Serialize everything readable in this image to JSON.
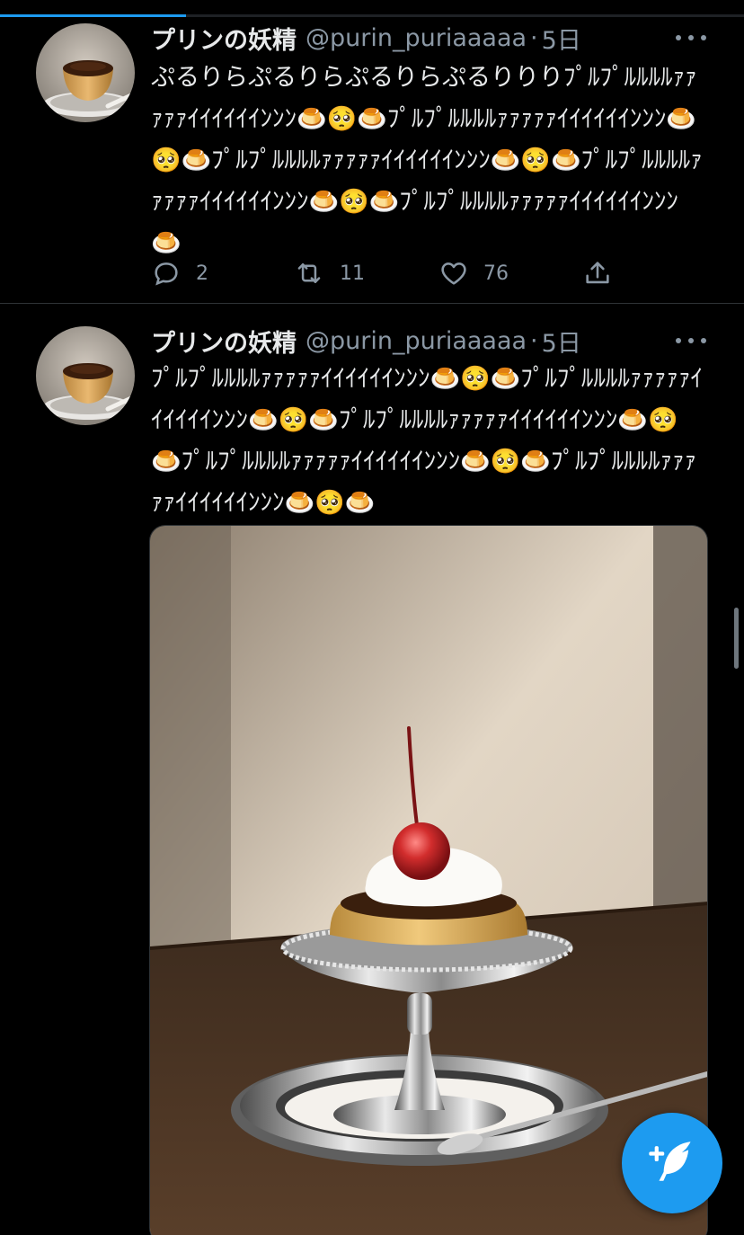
{
  "progress": {
    "fraction": 0.25,
    "color": "#1d9bf0"
  },
  "tweets": [
    {
      "author_name": "プリンの妖精",
      "handle": "@purin_puriaaaaa",
      "separator": "·",
      "time": "5日",
      "text": "ぷるりらぷるりらぷるりらぷるりりりﾌﾟﾙﾌﾟﾙﾙﾙﾙｧｧｧｧｧｲｲｲｲｲｲﾝﾝﾝ🍮🥺🍮ﾌﾟﾙﾌﾟﾙﾙﾙﾙｧｧｧｧｧｲｲｲｲｲｲﾝﾝﾝ🍮🥺🍮ﾌﾟﾙﾌﾟﾙﾙﾙﾙｧｧｧｧｧｲｲｲｲｲｲﾝﾝﾝ🍮🥺🍮ﾌﾟﾙﾌﾟﾙﾙﾙﾙｧｧｧｧｧｲｲｲｲｲｲﾝﾝﾝ🍮🥺🍮ﾌﾟﾙﾌﾟﾙﾙﾙﾙｧｧｧｧｧｲｲｲｲｲｲﾝﾝﾝ🍮",
      "reply_count": "2",
      "retweet_count": "11",
      "like_count": "76"
    },
    {
      "author_name": "プリンの妖精",
      "handle": "@purin_puriaaaaa",
      "separator": "·",
      "time": "5日",
      "text": "ﾌﾟﾙﾌﾟﾙﾙﾙﾙｧｧｧｧｧｲｲｲｲｲｲﾝﾝﾝ🍮🥺🍮ﾌﾟﾙﾌﾟﾙﾙﾙﾙｧｧｧｧｧｲｲｲｲｲｲﾝﾝﾝ🍮🥺🍮ﾌﾟﾙﾌﾟﾙﾙﾙﾙｧｧｧｧｧｲｲｲｲｲｲﾝﾝﾝ🍮🥺🍮ﾌﾟﾙﾌﾟﾙﾙﾙﾙｧｧｧｧｧｲｲｲｲｲｲﾝﾝﾝ🍮🥺🍮ﾌﾟﾙﾌﾟﾙﾙﾙﾙｧｧｧｧｧｲｲｲｲｲｲﾝﾝﾝ🍮🥺🍮"
    }
  ],
  "icons": {
    "reply": "reply-icon",
    "retweet": "retweet-icon",
    "like": "heart-icon",
    "share": "share-icon",
    "more": "more-icon",
    "compose": "compose-icon"
  },
  "colors": {
    "accent": "#1d9bf0",
    "background": "#000000",
    "secondary_text": "#8b98a5",
    "divider": "#2f3336"
  }
}
